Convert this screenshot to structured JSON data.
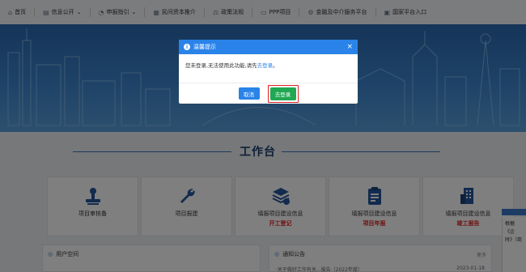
{
  "nav": {
    "items": [
      {
        "icon": "home-icon",
        "glyph": "⌂",
        "label": "首页",
        "chevron": ""
      },
      {
        "icon": "folder-icon",
        "glyph": "▤",
        "label": "信息公开",
        "chevron": "⌄"
      },
      {
        "icon": "gauge-icon",
        "glyph": "◔",
        "label": "申报指引",
        "chevron": "⌄"
      },
      {
        "icon": "document-icon",
        "glyph": "▦",
        "label": "民间资本推介",
        "chevron": ""
      },
      {
        "icon": "scale-icon",
        "glyph": "⚖",
        "label": "政策法规",
        "chevron": ""
      },
      {
        "icon": "monitor-icon",
        "glyph": "▭",
        "label": "PPP项目",
        "chevron": ""
      },
      {
        "icon": "finance-icon",
        "glyph": "⚙",
        "label": "金融及中介服务平台",
        "chevron": ""
      },
      {
        "icon": "national-icon",
        "glyph": "▣",
        "label": "国家平台入口",
        "chevron": ""
      }
    ]
  },
  "workbench": {
    "title": "工作台"
  },
  "cards": [
    {
      "label": "项目审核备",
      "sub": "",
      "icon": "stamp-icon"
    },
    {
      "label": "项目报建",
      "sub": "",
      "icon": "wrench-icon"
    },
    {
      "label": "填报项目建设信息",
      "sub": "开工登记",
      "icon": "stack-icon"
    },
    {
      "label": "填报项目建设信息",
      "sub": "项目年报",
      "icon": "clipboard-icon"
    },
    {
      "label": "填报项目建设信息",
      "sub": "竣工报告",
      "icon": "building-icon"
    }
  ],
  "user_panel": {
    "title": "用户空间"
  },
  "notice_panel": {
    "title": "通知公告",
    "more": "更多",
    "first_item": "·关于做好工作有关...报告（2022年度）",
    "first_date": "2023-01-18"
  },
  "side": {
    "text1": "根据《企",
    "text2": "时》（商"
  },
  "dialog": {
    "title": "温馨提示",
    "message": "您未登录,无法使用此功能,请先",
    "link": "去登录",
    "message_end": "。",
    "cancel_label": "取消",
    "login_label": "去登录"
  },
  "colors": {
    "accent": "#2a83e8",
    "confirm": "#21a852",
    "highlight": "#e02020",
    "title": "#1d3f72"
  }
}
